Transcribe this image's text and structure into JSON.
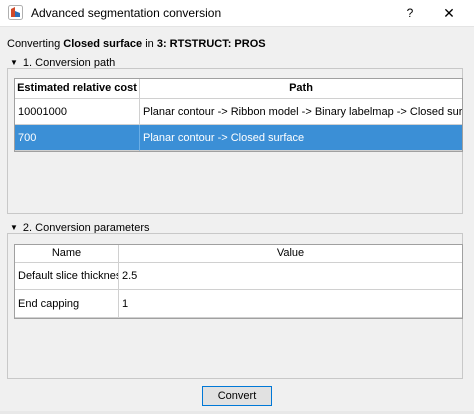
{
  "window": {
    "title": "Advanced segmentation conversion",
    "help_label": "?",
    "close_label": "✕",
    "icon": "slicer-app-icon"
  },
  "converting": {
    "prefix": "Converting",
    "representation": "Closed surface",
    "in_label": "in",
    "segmentation": "3: RTSTRUCT: PROS"
  },
  "conversion_path": {
    "section_label": "1. Conversion path",
    "columns": [
      "Estimated relative cost",
      "Path"
    ],
    "rows": [
      {
        "cost": "10001000",
        "path": "Planar contour -> Ribbon model -> Binary labelmap -> Closed surface",
        "selected": false
      },
      {
        "cost": "700",
        "path": "Planar contour -> Closed surface",
        "selected": true
      }
    ]
  },
  "conversion_parameters": {
    "section_label": "2. Conversion parameters",
    "columns": [
      "Name",
      "Value"
    ],
    "rows": [
      {
        "name": "Default slice thickness",
        "value": "2.5"
      },
      {
        "name": "End capping",
        "value": "1"
      }
    ]
  },
  "buttons": {
    "convert_label": "Convert"
  },
  "colors": {
    "selection": "#3b8fd6",
    "focus_border": "#0078d7"
  }
}
